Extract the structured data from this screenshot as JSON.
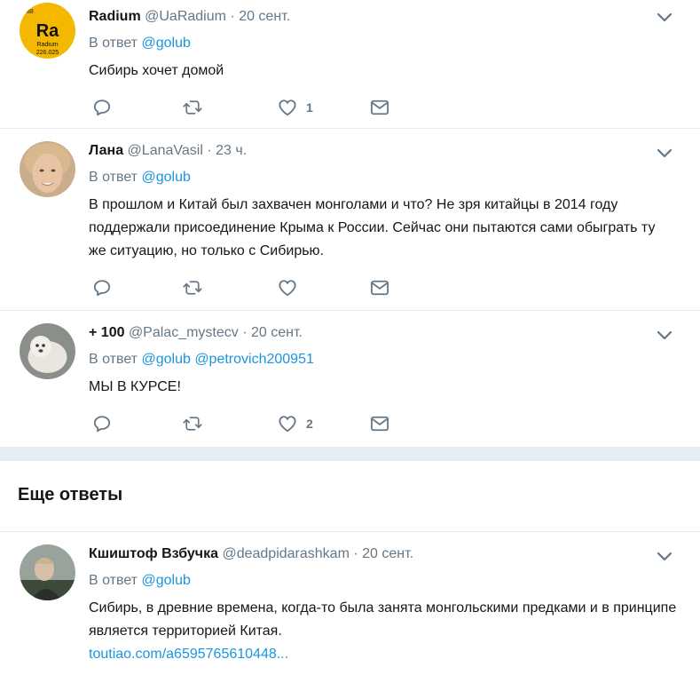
{
  "reply_label": "В ответ",
  "tweets": [
    {
      "name": "Radium",
      "handle": "@UaRadium",
      "dot": "·",
      "time": "20 сент.",
      "reply_to": [
        "@golub"
      ],
      "text": "Сибирь хочет домой",
      "avatar_text": {
        "symbol": "Ra",
        "label": "Radium",
        "number": "88",
        "mass": "226.025"
      },
      "likes": "1",
      "retweets": "",
      "replies": ""
    },
    {
      "name": "Лана",
      "handle": "@LanaVasil",
      "dot": "·",
      "time": "23 ч.",
      "reply_to": [
        "@golub"
      ],
      "text": "В прошлом и Китай был захвачен монголами и что?  Не зря китайцы в 2014 году поддержали присоединение Крыма к России. Сейчас они пытаются сами обыграть ту же ситуацию, но только с Сибирью.",
      "likes": "",
      "retweets": "",
      "replies": ""
    },
    {
      "name": "+ 100",
      "handle": "@Palac_mystecv",
      "dot": "·",
      "time": "20 сент.",
      "reply_to": [
        "@golub",
        "@petrovich200951"
      ],
      "text": "МЫ В КУРСЕ!",
      "likes": "2",
      "retweets": "",
      "replies": ""
    }
  ],
  "more_replies_title": "Еще ответы",
  "more_tweets": [
    {
      "name": "Кшиштоф Взбучка",
      "handle": "@deadpidarashkam",
      "dot": "·",
      "time": "20 сент.",
      "reply_to": [
        "@golub"
      ],
      "text": "Сибирь, в древние времена, когда-то была занята монгольскими предками и в принципе является территорией Китая.",
      "link": "toutiao.com/a6595765610448..."
    }
  ],
  "colors": {
    "accent": "#1b95e0",
    "secondary_text": "#657786",
    "divider": "#e6ecf0",
    "radium_avatar": "#f5b800"
  },
  "icons": [
    "reply-icon",
    "retweet-icon",
    "like-icon",
    "dm-icon",
    "chevron-down-icon"
  ]
}
